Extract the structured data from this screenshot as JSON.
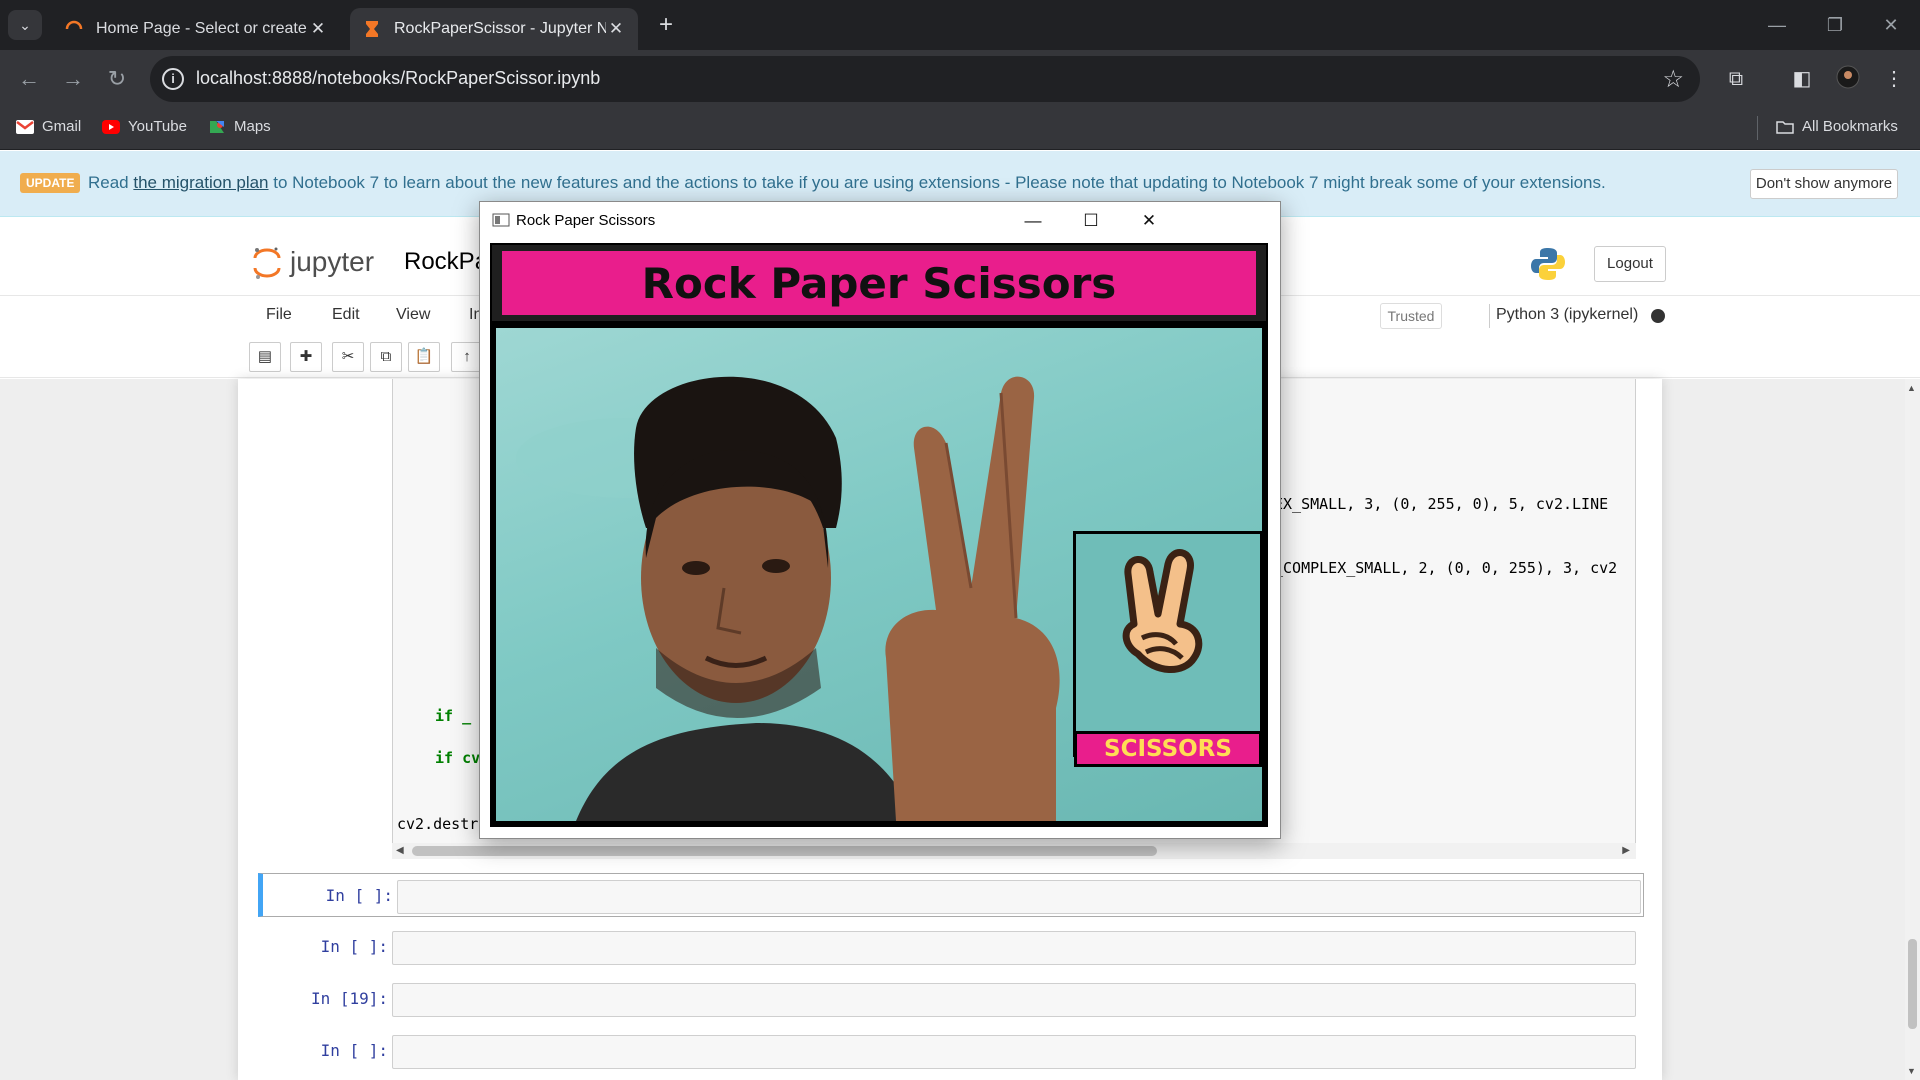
{
  "browser": {
    "tabs": [
      {
        "title": "Home Page - Select or create a",
        "active": false
      },
      {
        "title": "RockPaperScissor - Jupyter Not",
        "active": true
      }
    ],
    "url": "localhost:8888/notebooks/RockPaperScissor.ipynb",
    "bookmarks": [
      "Gmail",
      "YouTube",
      "Maps"
    ],
    "all_bookmarks": "All Bookmarks"
  },
  "banner": {
    "badge": "UPDATE",
    "text_before": "Read ",
    "link": "the migration plan",
    "text_after": " to Notebook 7 to learn about the new features and the actions to take if you are using extensions - Please note that updating to Notebook 7 might break some of your extensions.",
    "dismiss": "Don't show anymore"
  },
  "jupyter": {
    "logo_text": "jupyter",
    "notebook_name": "RockPa",
    "logout": "Logout",
    "menu": [
      "File",
      "Edit",
      "View",
      "In"
    ],
    "trusted": "Trusted",
    "kernel": "Python 3 (ipykernel)"
  },
  "code_fragments": {
    "line1": "EX_SMALL, 3, (0, 255, 0), 5, cv2.LINE",
    "line2": "_COMPLEX_SMALL, 2, (0, 0, 255), 3, cv2",
    "if1": "if _",
    "if2": "if cv",
    "destroy": "cv2.destr"
  },
  "cells": [
    {
      "prompt": "In [ ]:",
      "selected": true
    },
    {
      "prompt": "In [ ]:",
      "selected": false
    },
    {
      "prompt": "In [19]:",
      "selected": false
    },
    {
      "prompt": "In [ ]:",
      "selected": false
    }
  ],
  "popup": {
    "title": "Rock Paper Scissors",
    "game_title": "Rock Paper Scissors",
    "cpu_move": "SCISSORS"
  }
}
